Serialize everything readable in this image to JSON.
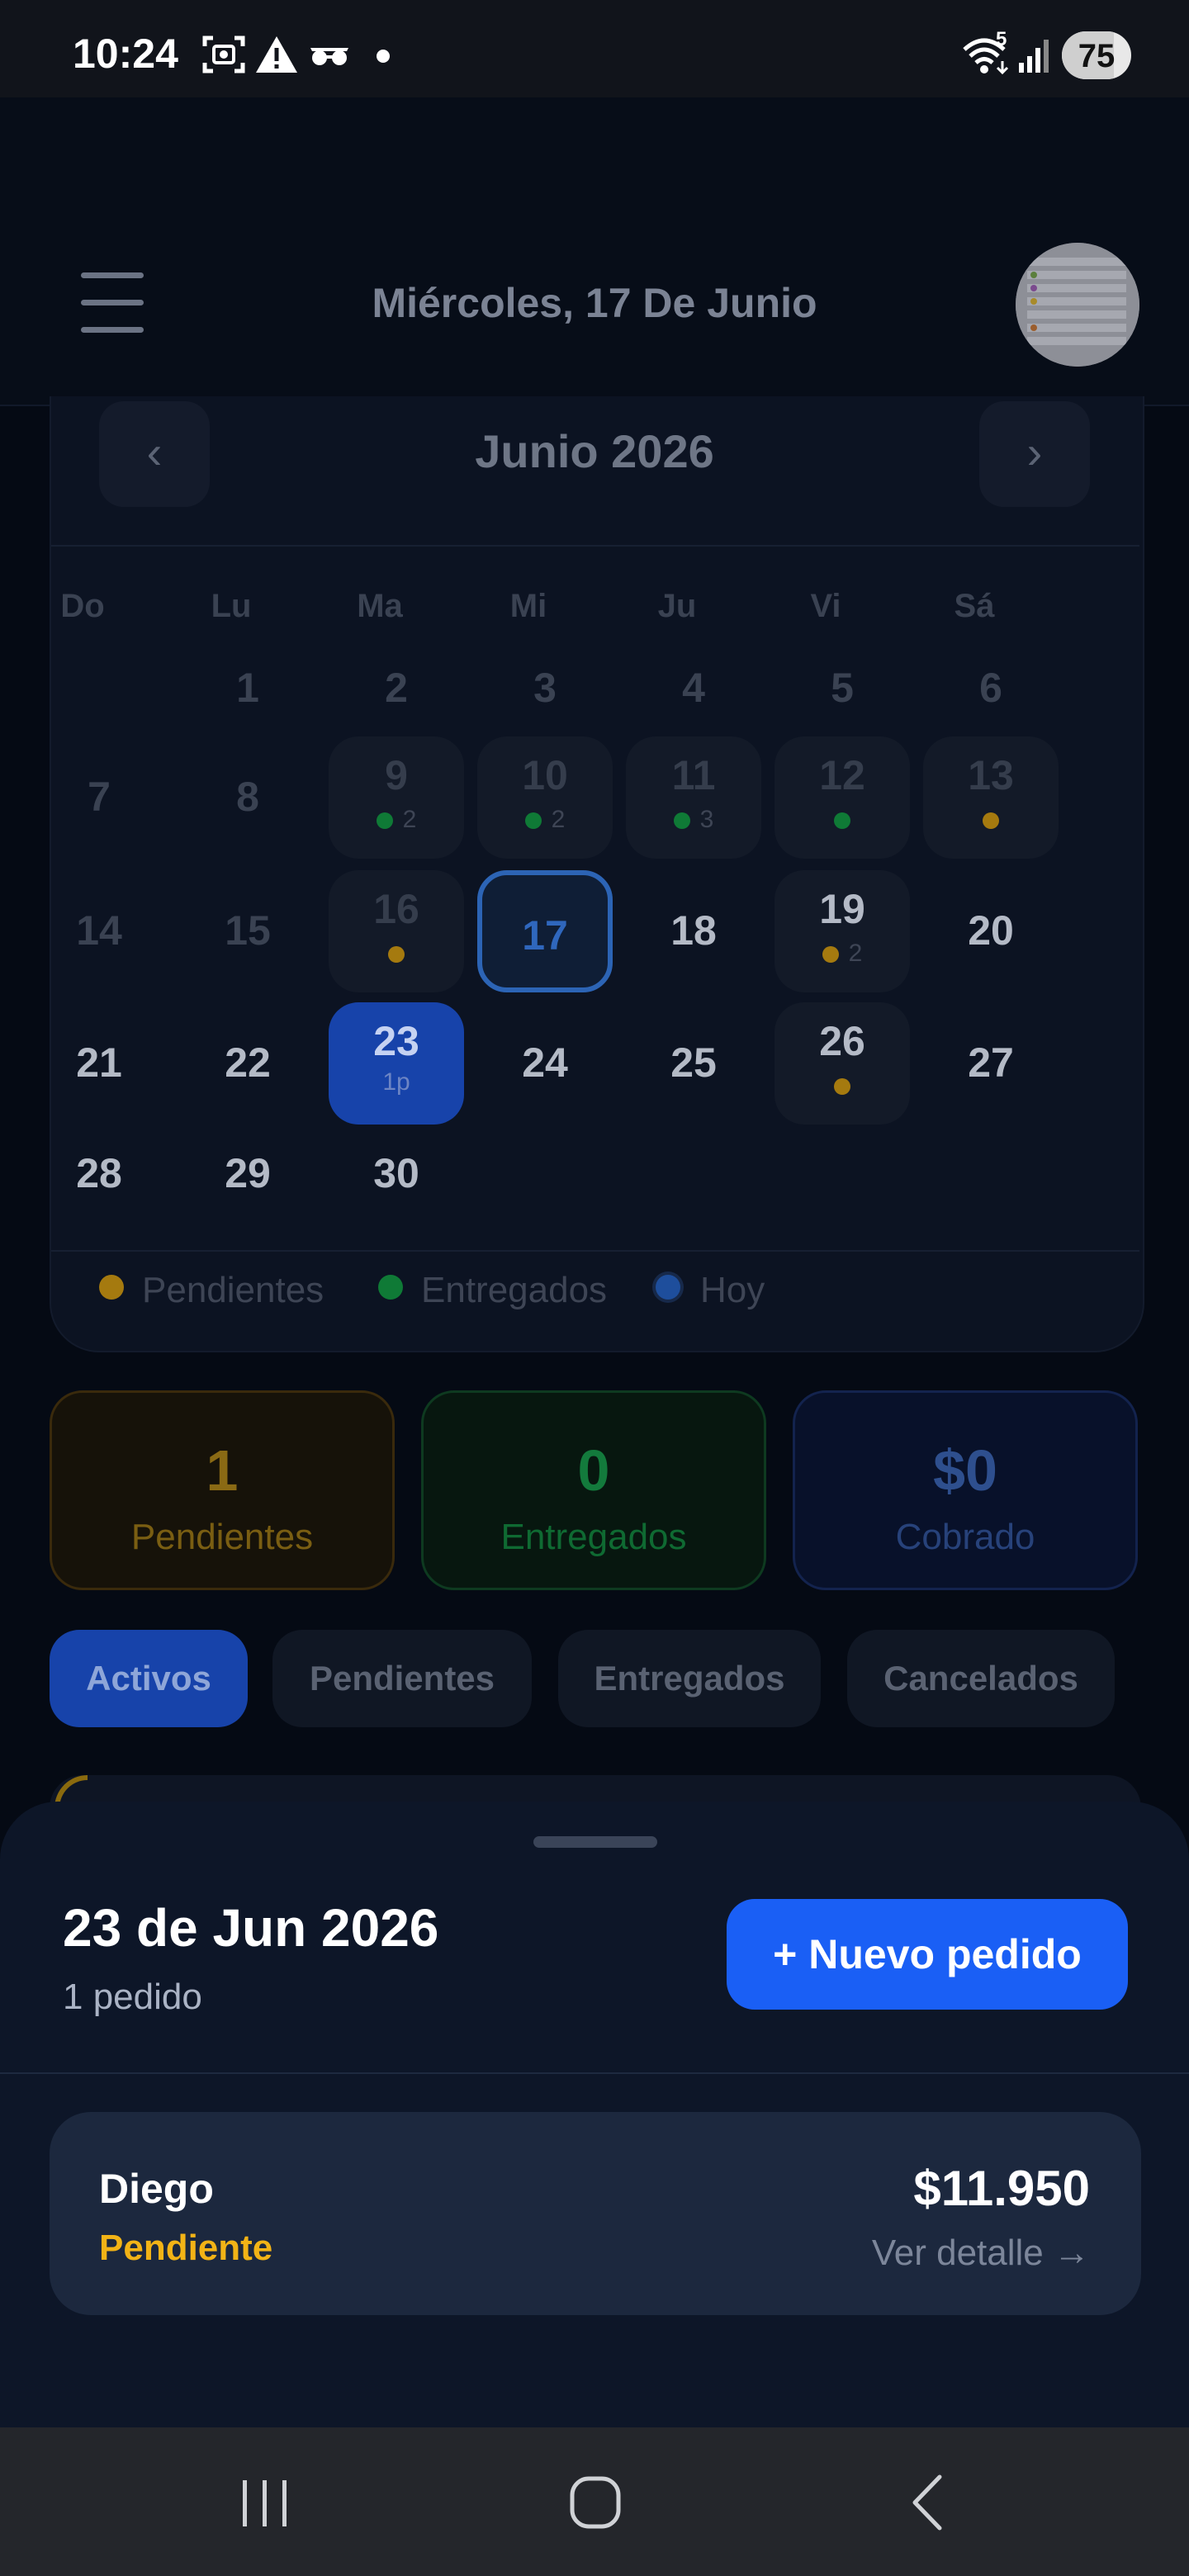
{
  "status_bar": {
    "time": "10:24",
    "battery": "75",
    "battery_level": 0.75,
    "left_icons": [
      "screenshot-icon",
      "warning-icon",
      "incognito-icon",
      "dot-icon"
    ],
    "right_icons": [
      "wifi-icon",
      "signal-icon",
      "battery-icon"
    ],
    "wifi_badge": "5"
  },
  "header": {
    "date": "Miércoles, 17 De Junio",
    "menu_icon": "hamburger-menu-icon",
    "avatar_icon": "avatar"
  },
  "calendar": {
    "month": "Junio 2026",
    "prev": "‹",
    "next": "›",
    "weekdays": [
      "Do",
      "Lu",
      "Ma",
      "Mi",
      "Ju",
      "Vi",
      "Sá"
    ],
    "days": [
      {
        "n": "1"
      },
      {
        "n": "2"
      },
      {
        "n": "3"
      },
      {
        "n": "4"
      },
      {
        "n": "5"
      },
      {
        "n": "6"
      },
      {
        "n": "7"
      },
      {
        "n": "8"
      },
      {
        "n": "9",
        "dot": "ent",
        "count": "2"
      },
      {
        "n": "10",
        "dot": "ent",
        "count": "2"
      },
      {
        "n": "11",
        "dot": "ent",
        "count": "3"
      },
      {
        "n": "12",
        "dot": "ent"
      },
      {
        "n": "13",
        "dot": "pend"
      },
      {
        "n": "14"
      },
      {
        "n": "15"
      },
      {
        "n": "16",
        "dot": "pend"
      },
      {
        "n": "17",
        "today": true
      },
      {
        "n": "18"
      },
      {
        "n": "19",
        "dot": "pend",
        "count": "2"
      },
      {
        "n": "20"
      },
      {
        "n": "21"
      },
      {
        "n": "22"
      },
      {
        "n": "23",
        "selected": true,
        "sub": "1p"
      },
      {
        "n": "24"
      },
      {
        "n": "25"
      },
      {
        "n": "26",
        "dot": "pend"
      },
      {
        "n": "27"
      },
      {
        "n": "28"
      },
      {
        "n": "29"
      },
      {
        "n": "30"
      }
    ],
    "legend": {
      "pending": "Pendientes",
      "delivered": "Entregados",
      "today": "Hoy"
    }
  },
  "stats": {
    "pending_value": "1",
    "pending_label": "Pendientes",
    "delivered_value": "0",
    "delivered_label": "Entregados",
    "collected_value": "$0",
    "collected_label": "Cobrado"
  },
  "tabs": [
    "Activos",
    "Pendientes",
    "Entregados",
    "Cancelados"
  ],
  "sheet": {
    "date": "23 de Jun 2026",
    "count": "1 pedido",
    "new_order": "+ Nuevo pedido",
    "order": {
      "customer": "Diego",
      "status": "Pendiente",
      "amount": "$11.950",
      "detail": "Ver detalle →"
    }
  },
  "colors": {
    "accent": "#1a5ff5",
    "pending": "#f2b316",
    "delivered": "#1fa64f"
  }
}
